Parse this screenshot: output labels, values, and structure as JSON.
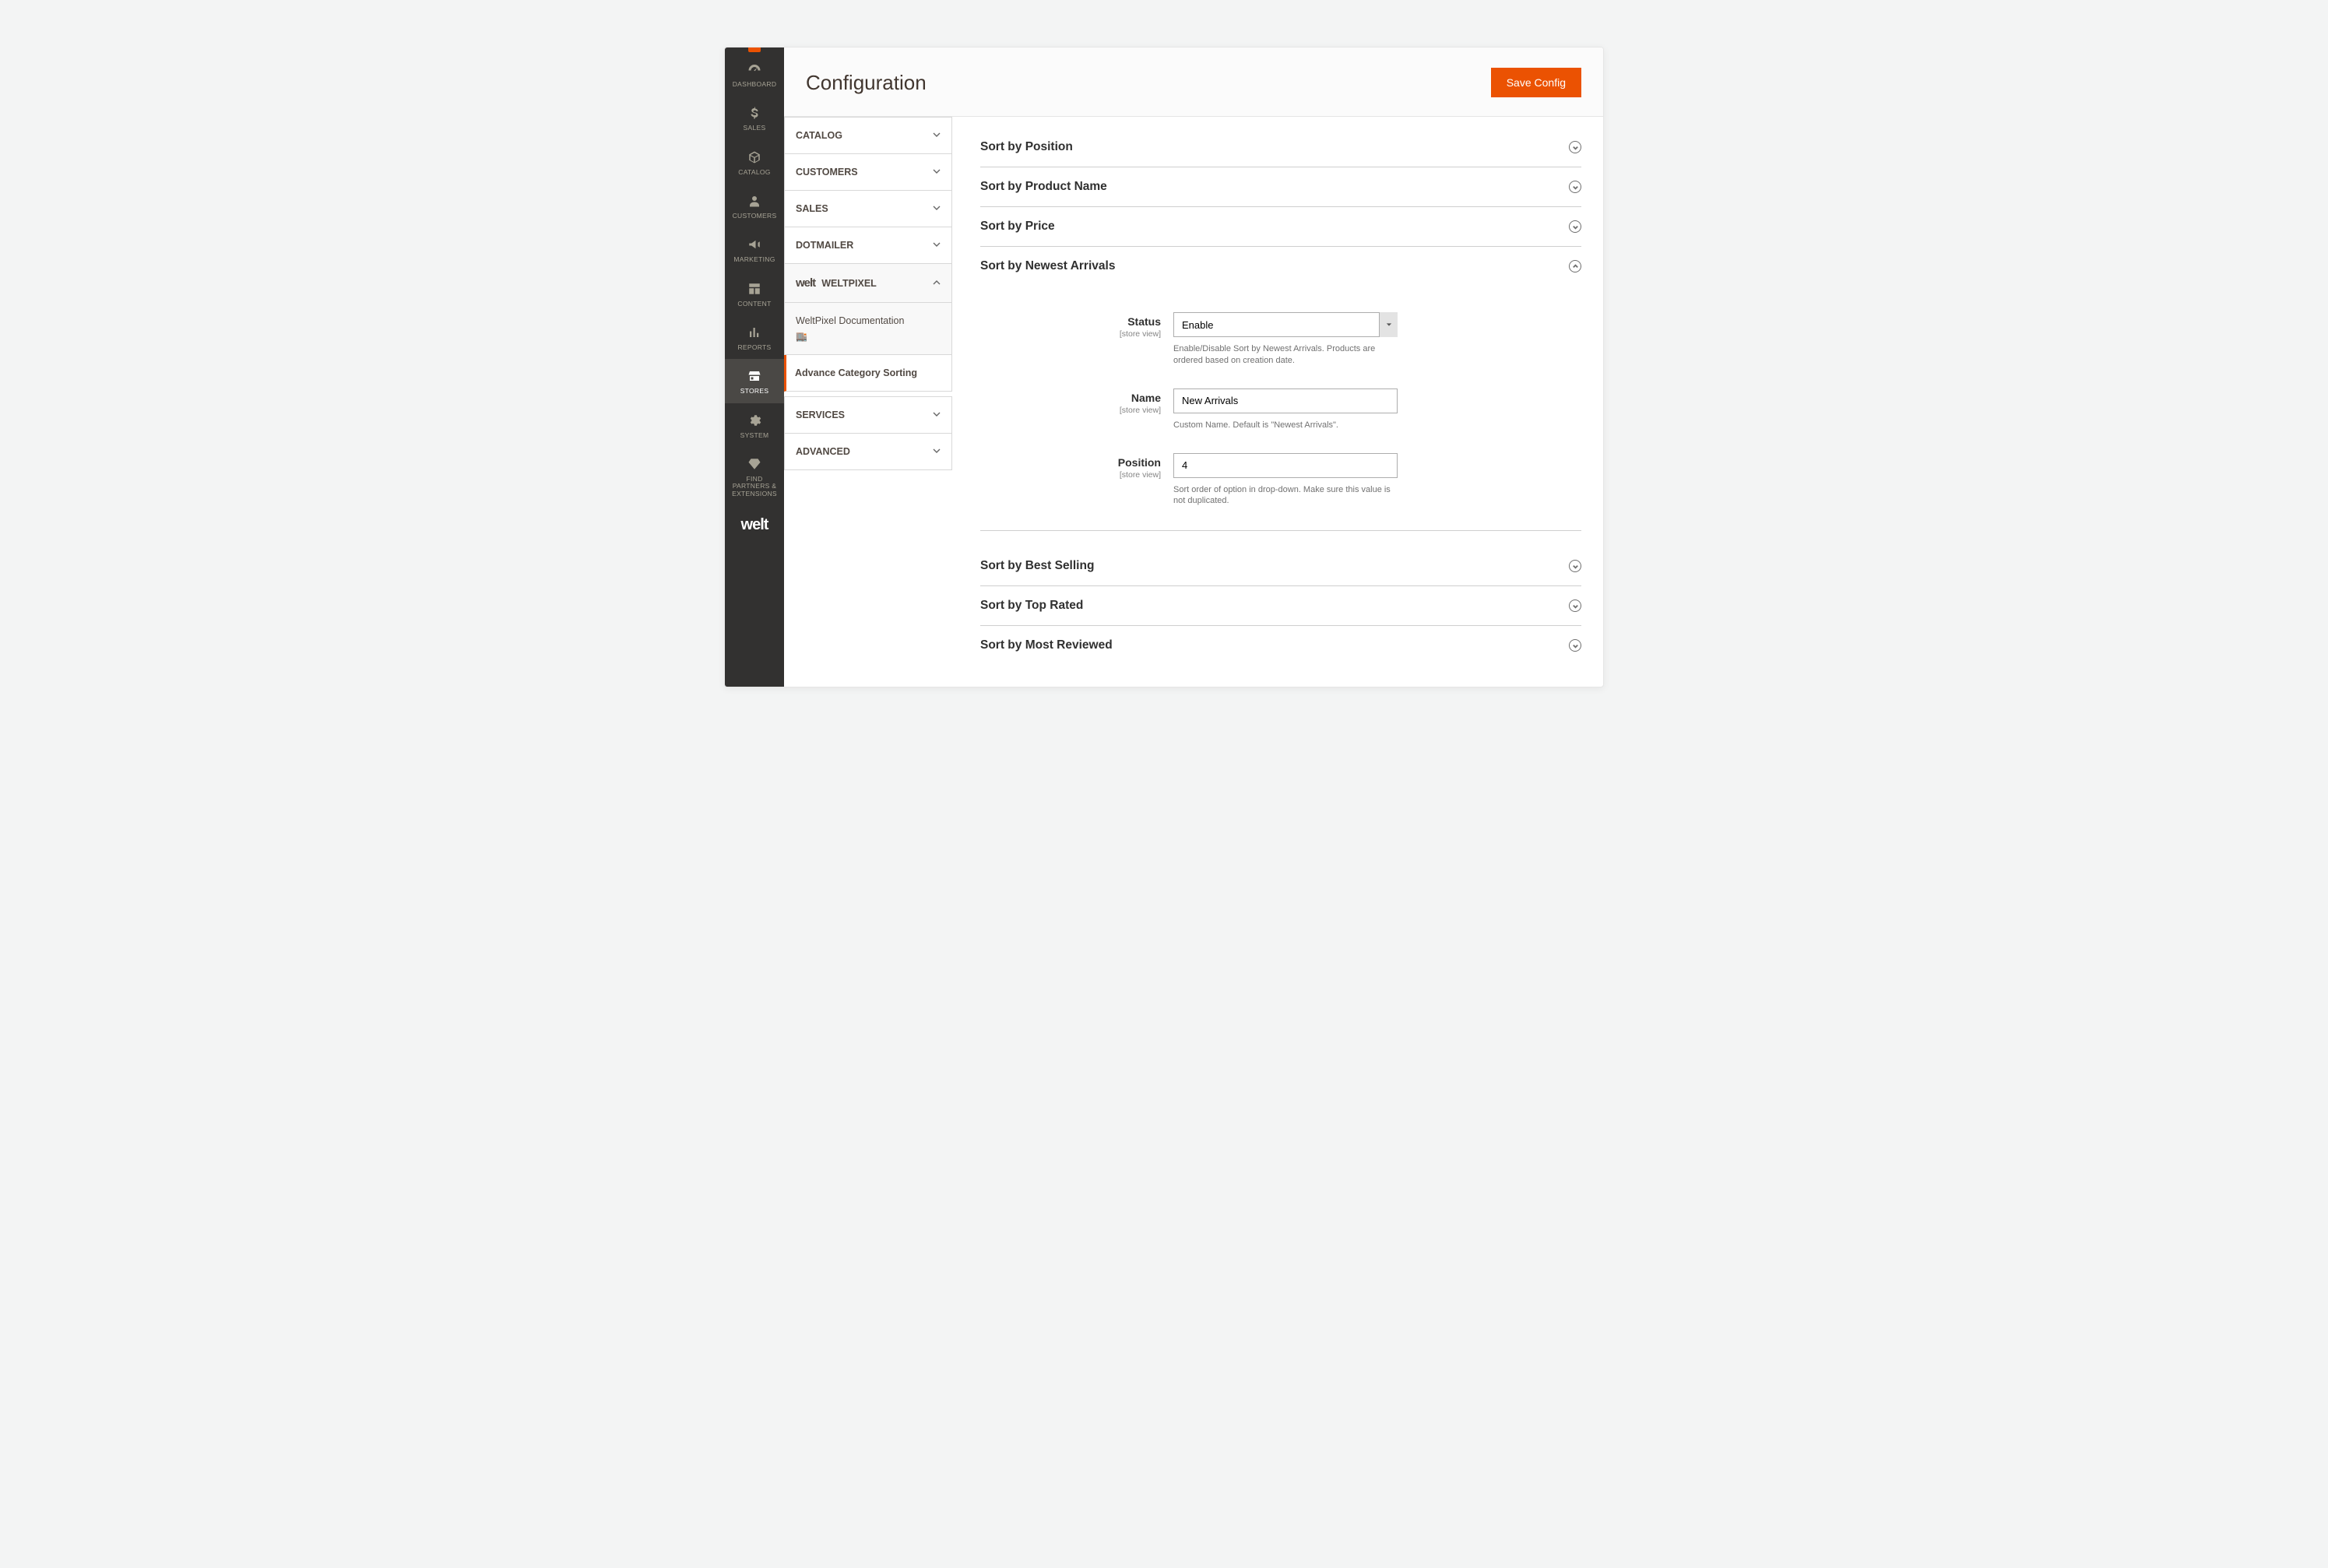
{
  "header": {
    "title": "Configuration",
    "save_label": "Save Config"
  },
  "sidebar": {
    "items": [
      {
        "label": "DASHBOARD"
      },
      {
        "label": "SALES"
      },
      {
        "label": "CATALOG"
      },
      {
        "label": "CUSTOMERS"
      },
      {
        "label": "MARKETING"
      },
      {
        "label": "CONTENT"
      },
      {
        "label": "REPORTS"
      },
      {
        "label": "STORES"
      },
      {
        "label": "SYSTEM"
      },
      {
        "label": "FIND PARTNERS & EXTENSIONS"
      }
    ],
    "footer_logo": "welt"
  },
  "config_tabs": {
    "catalog": "CATALOG",
    "customers": "CUSTOMERS",
    "sales": "SALES",
    "dotmailer": "DOTMAILER",
    "weltpixel_brand": "welt",
    "weltpixel_label": "WELTPIXEL",
    "sub_docs": "WeltPixel Documentation",
    "sub_sorting": "Advance Category Sorting",
    "services": "SERVICES",
    "advanced": "ADVANCED"
  },
  "sections": {
    "position": "Sort by Position",
    "product_name": "Sort by Product Name",
    "price": "Sort by Price",
    "newest": "Sort by Newest Arrivals",
    "best_selling": "Sort by Best Selling",
    "top_rated": "Sort by Top Rated",
    "most_reviewed": "Sort by Most Reviewed"
  },
  "scope_label": "[store view]",
  "newest_fields": {
    "status": {
      "label": "Status",
      "value": "Enable",
      "note": "Enable/Disable Sort by Newest Arrivals. Products are ordered based on creation date."
    },
    "name": {
      "label": "Name",
      "value": "New Arrivals",
      "note": "Custom Name. Default is \"Newest Arrivals\"."
    },
    "position": {
      "label": "Position",
      "value": "4",
      "note": "Sort order of option in drop-down. Make sure this value is not duplicated."
    }
  },
  "colors": {
    "accent": "#eb5202",
    "sidebar": "#323130"
  }
}
